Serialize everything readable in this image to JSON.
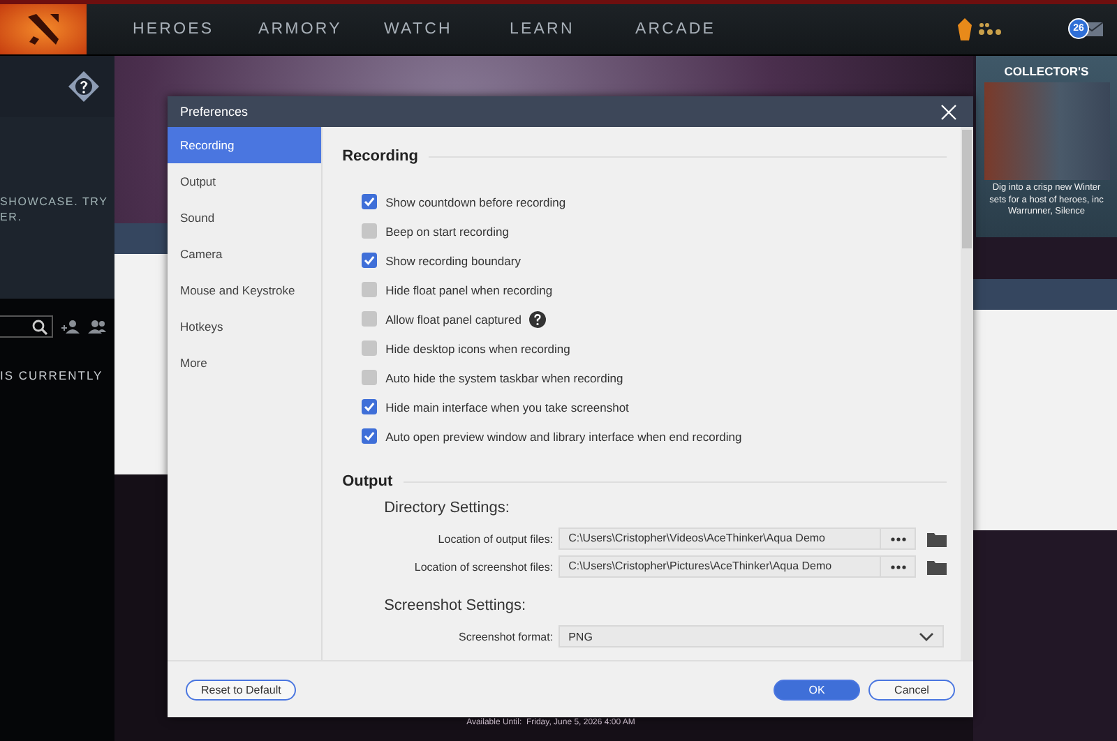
{
  "game": {
    "nav": [
      {
        "label": "HEROES"
      },
      {
        "label": "ARMORY"
      },
      {
        "label": "WATCH"
      },
      {
        "label": "LEARN"
      },
      {
        "label": "ARCADE"
      }
    ],
    "notification_count": "26",
    "left_panel": {
      "showcase_lines": [
        "SHOWCASE. TRY",
        "ER."
      ],
      "status_text": "IS CURRENTLY"
    },
    "promo": {
      "title": "COLLECTOR'S",
      "lines": [
        "Dig into a crisp new Winter",
        "sets for a host of heroes, inc",
        "Warrunner, Silence"
      ]
    },
    "availability": "Available Until:  Friday, June 5, 2026 4:00 AM"
  },
  "dialog": {
    "title": "Preferences",
    "sidebar": [
      {
        "label": "Recording",
        "selected": true
      },
      {
        "label": "Output",
        "selected": false
      },
      {
        "label": "Sound",
        "selected": false
      },
      {
        "label": "Camera",
        "selected": false
      },
      {
        "label": "Mouse and Keystroke",
        "selected": false
      },
      {
        "label": "Hotkeys",
        "selected": false
      },
      {
        "label": "More",
        "selected": false
      }
    ],
    "sections": [
      {
        "kind": "checkboxes",
        "heading": "Recording",
        "options": [
          {
            "label": "Show countdown before recording",
            "checked": true
          },
          {
            "label": "Beep on start recording",
            "checked": false
          },
          {
            "label": "Show recording boundary",
            "checked": true
          },
          {
            "label": "Hide float panel when recording",
            "checked": false
          },
          {
            "label": "Allow float panel captured",
            "checked": false,
            "help": true
          },
          {
            "label": "Hide desktop icons when recording",
            "checked": false
          },
          {
            "label": "Auto hide the system taskbar when recording",
            "checked": false
          },
          {
            "label": "Hide main interface when you take screenshot",
            "checked": true
          },
          {
            "label": "Auto open preview window and library interface when end recording",
            "checked": true
          }
        ]
      },
      {
        "kind": "groups",
        "heading": "Output",
        "groups": [
          {
            "title": "Directory Settings:",
            "rows": [
              {
                "kind": "path",
                "label": "Location of output files:",
                "value": "C:\\Users\\Cristopher\\Videos\\AceThinker\\Aqua Demo"
              },
              {
                "kind": "path",
                "label": "Location of screenshot files:",
                "value": "C:\\Users\\Cristopher\\Pictures\\AceThinker\\Aqua Demo"
              }
            ]
          },
          {
            "title": "Screenshot Settings:",
            "rows": [
              {
                "kind": "select",
                "label": "Screenshot format:",
                "value": "PNG"
              }
            ]
          }
        ]
      }
    ],
    "buttons": [
      {
        "kind": "secondary",
        "label": "Reset to Default"
      },
      {
        "kind": "primary",
        "label": "OK"
      },
      {
        "kind": "secondary",
        "label": "Cancel"
      }
    ]
  }
}
